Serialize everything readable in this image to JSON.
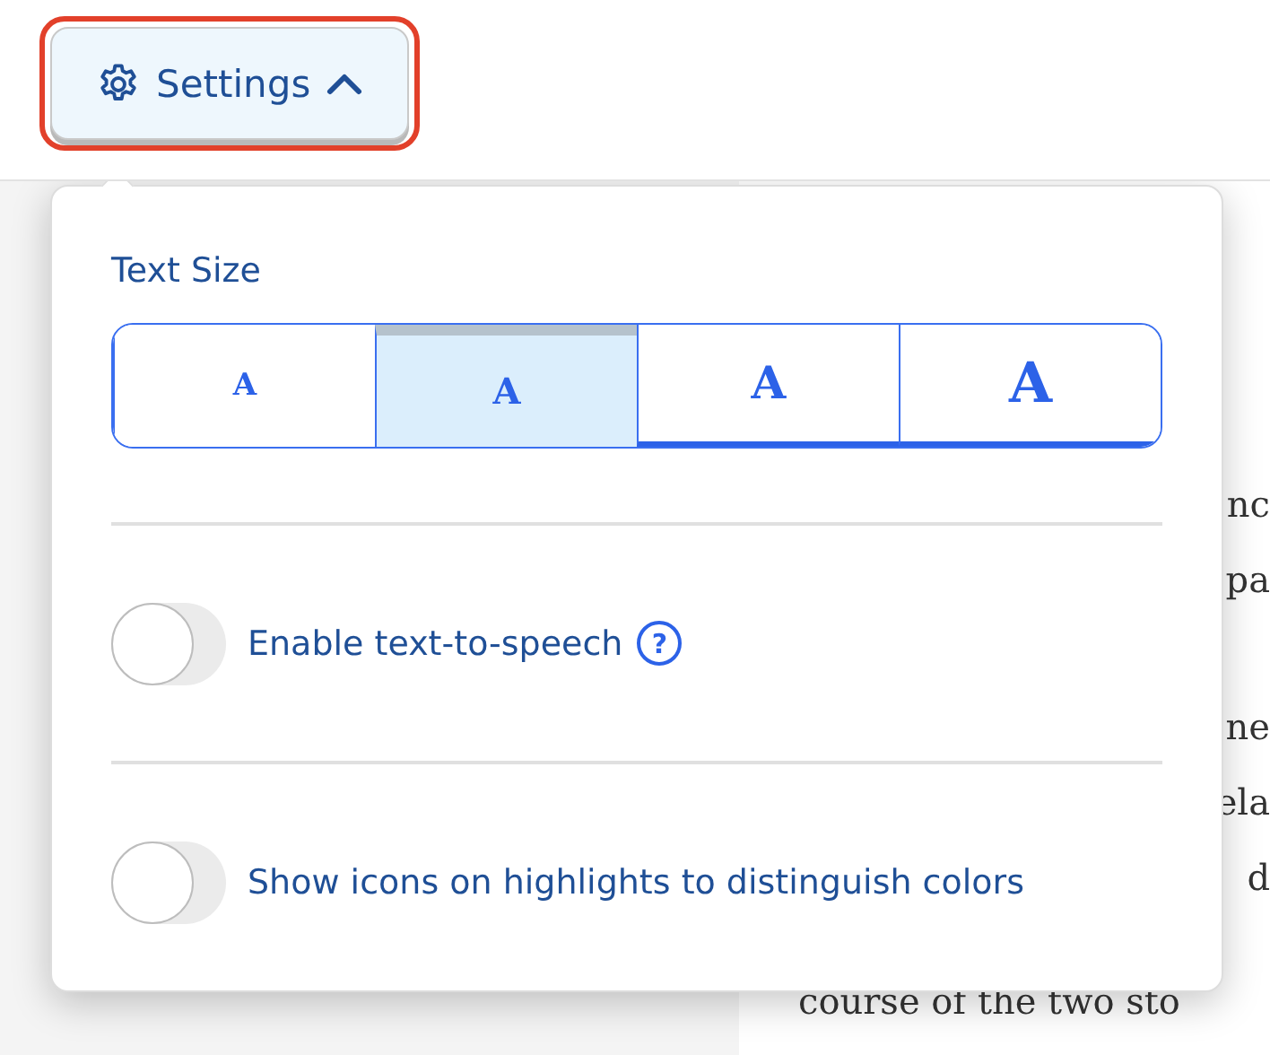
{
  "settings_button": {
    "label": "Settings",
    "expanded": true
  },
  "panel": {
    "title": "Text Size",
    "text_sizes": [
      {
        "label": "A",
        "selected": false
      },
      {
        "label": "A",
        "selected": true
      },
      {
        "label": "A",
        "selected": false
      },
      {
        "label": "A",
        "selected": false
      }
    ],
    "toggles": [
      {
        "label": "Enable text-to-speech",
        "on": false,
        "help": "?"
      },
      {
        "label": "Show icons on highlights to distinguish colors",
        "on": false
      }
    ]
  },
  "article_fragments": [
    "nc",
    "pa",
    "ne",
    "ela",
    "d",
    "course of the two sto"
  ]
}
